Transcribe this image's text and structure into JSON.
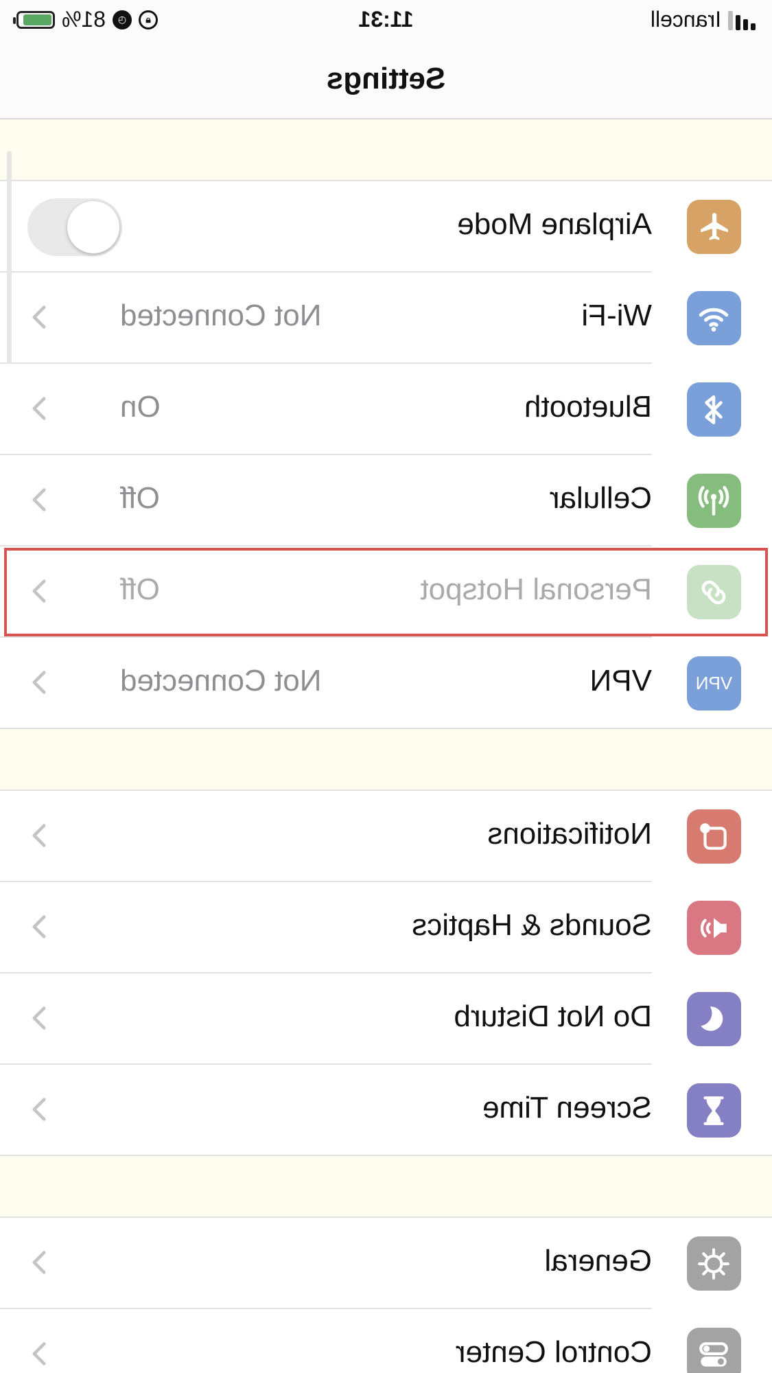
{
  "status_bar": {
    "carrier": "Irancell",
    "time": "11:31",
    "battery_percent": "81%",
    "battery_level": 0.81,
    "icons": [
      "signal-icon",
      "alarm-icon",
      "orientation-lock-icon",
      "battery-charging-icon"
    ]
  },
  "nav": {
    "title": "Settings"
  },
  "sections": [
    {
      "rows": [
        {
          "label": "Airplane Mode",
          "icon": "airplane-icon",
          "color": "#d6a266",
          "toggle": false
        },
        {
          "label": "Wi-Fi",
          "value": "Not Connected",
          "icon": "wifi-icon",
          "color": "#7b9fd9"
        },
        {
          "label": "Bluetooth",
          "value": "On",
          "icon": "bluetooth-icon",
          "color": "#7b9fd9"
        },
        {
          "label": "Cellular",
          "value": "Off",
          "icon": "cellular-antenna-icon",
          "color": "#86bd7f"
        },
        {
          "label": "Personal Hotspot",
          "value": "Off",
          "icon": "hotspot-link-icon",
          "color": "#86bd7f",
          "disabled": true,
          "highlighted": true
        },
        {
          "label": "VPN",
          "value": "Not Connected",
          "icon": "vpn-icon",
          "icon_text": "VPN",
          "color": "#7b9fd9"
        }
      ]
    },
    {
      "rows": [
        {
          "label": "Notifications",
          "icon": "notifications-icon",
          "color": "#d77b71"
        },
        {
          "label": "Sounds & Haptics",
          "icon": "speaker-icon",
          "color": "#d97882"
        },
        {
          "label": "Do Not Disturb",
          "icon": "moon-icon",
          "color": "#857fc4"
        },
        {
          "label": "Screen Time",
          "icon": "hourglass-icon",
          "color": "#857fc4"
        }
      ]
    },
    {
      "rows": [
        {
          "label": "General",
          "icon": "gear-icon",
          "color": "#a3a3a3"
        },
        {
          "label": "Control Center",
          "icon": "switches-icon",
          "color": "#a3a3a3"
        }
      ]
    }
  ]
}
